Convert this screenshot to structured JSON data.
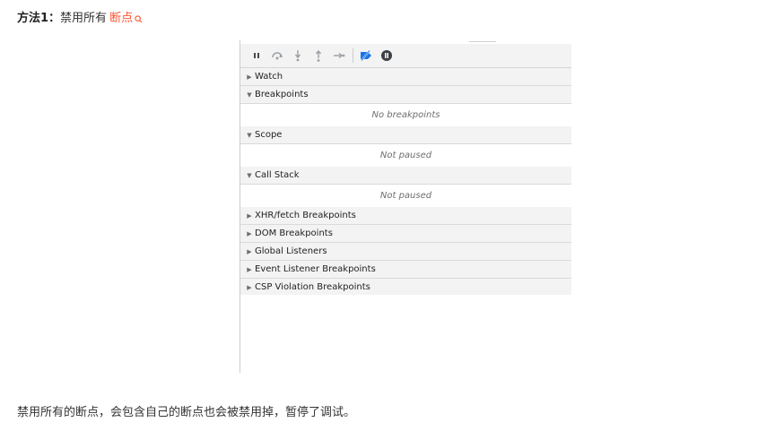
{
  "heading": {
    "method_label": "方法1：",
    "text": "禁用所有",
    "link_text": "断点"
  },
  "devtools": {
    "toolbar": {
      "buttons": [
        {
          "name": "pause-script",
          "icon": "pause-icon",
          "title": "Pause script execution"
        },
        {
          "name": "step-over",
          "icon": "step-over-icon",
          "title": "Step over next function call"
        },
        {
          "name": "step-into",
          "icon": "step-into-icon",
          "title": "Step into next function call"
        },
        {
          "name": "step-out",
          "icon": "step-out-icon",
          "title": "Step out of current function"
        },
        {
          "name": "step",
          "icon": "step-icon",
          "title": "Step"
        },
        {
          "name": "deactivate-breakpoints",
          "icon": "breakpoints-deactivated-icon",
          "title": "Deactivate breakpoints",
          "active_color": "#1a73e8"
        },
        {
          "name": "pause-on-exceptions",
          "icon": "pause-on-exceptions-icon",
          "title": "Pause on exceptions"
        }
      ]
    },
    "sections": {
      "watch": {
        "label": "Watch",
        "expanded": false
      },
      "breakpoints": {
        "label": "Breakpoints",
        "expanded": true,
        "empty_text": "No breakpoints"
      },
      "scope": {
        "label": "Scope",
        "expanded": true,
        "empty_text": "Not paused"
      },
      "call_stack": {
        "label": "Call Stack",
        "expanded": true,
        "empty_text": "Not paused"
      },
      "xhr_fetch": {
        "label": "XHR/fetch Breakpoints",
        "expanded": false
      },
      "dom": {
        "label": "DOM Breakpoints",
        "expanded": false
      },
      "global_listeners": {
        "label": "Global Listeners",
        "expanded": false
      },
      "event_listener": {
        "label": "Event Listener Breakpoints",
        "expanded": false
      },
      "csp_violation": {
        "label": "CSP Violation Breakpoints",
        "expanded": false
      }
    },
    "arrows": {
      "collapsed": "▶",
      "expanded": "▼"
    }
  },
  "caption": "禁用所有的断点，会包含自己的断点也会被禁用掉，暂停了调试。",
  "colors": {
    "link": "#fc5531",
    "toolbar_bg": "#f3f3f3",
    "accent_blue": "#1a73e8"
  }
}
